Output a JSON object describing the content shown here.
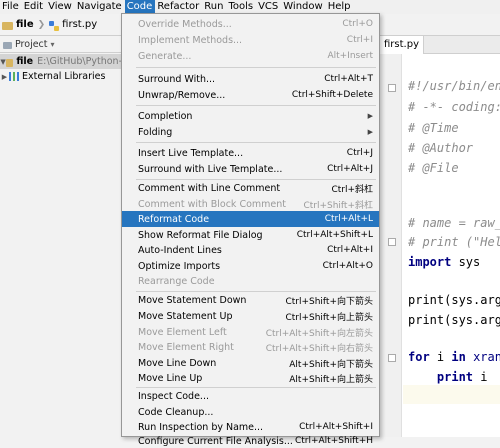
{
  "menubar": [
    "File",
    "Edit",
    "View",
    "Navigate",
    "Code",
    "Refactor",
    "Run",
    "Tools",
    "VCS",
    "Window",
    "Help"
  ],
  "navbar": {
    "folder": "file",
    "file": "first.py"
  },
  "project_panel": {
    "title": "Project",
    "root_name": "file",
    "root_path": "E:\\GitHub\\Python-",
    "libraries": "External Libraries"
  },
  "editor": {
    "tab_label": "first.py",
    "lines": [
      "#!/usr/bin/en",
      "# -*- coding:",
      "# @Time",
      "# @Author",
      "# @File",
      "",
      "",
      "# name = raw_",
      "# print (\"Hel",
      "import sys",
      "",
      "print(sys.arg",
      "print(sys.arg",
      "",
      "for i in xran",
      "    print i"
    ]
  },
  "code_menu": {
    "items": [
      {
        "label": "Override Methods...",
        "shortcut": "Ctrl+O",
        "disabled": true
      },
      {
        "label": "Implement Methods...",
        "shortcut": "Ctrl+I",
        "disabled": true
      },
      {
        "label": "Generate...",
        "shortcut": "Alt+Insert",
        "disabled": true
      },
      {
        "label": "Surround With...",
        "shortcut": "Ctrl+Alt+T"
      },
      {
        "label": "Unwrap/Remove...",
        "shortcut": "Ctrl+Shift+Delete"
      },
      {
        "label": "Completion",
        "shortcut": "",
        "submenu": true
      },
      {
        "label": "Folding",
        "shortcut": "",
        "submenu": true
      },
      {
        "label": "Insert Live Template...",
        "shortcut": "Ctrl+J"
      },
      {
        "label": "Surround with Live Template...",
        "shortcut": "Ctrl+Alt+J"
      },
      {
        "label": "Comment with Line Comment",
        "shortcut": "Ctrl+斜杠"
      },
      {
        "label": "Comment with Block Comment",
        "shortcut": "Ctrl+Shift+斜杠",
        "disabled": true
      },
      {
        "label": "Reformat Code",
        "shortcut": "Ctrl+Alt+L",
        "highlighted": true
      },
      {
        "label": "Show Reformat File Dialog",
        "shortcut": "Ctrl+Alt+Shift+L"
      },
      {
        "label": "Auto-Indent Lines",
        "shortcut": "Ctrl+Alt+I"
      },
      {
        "label": "Optimize Imports",
        "shortcut": "Ctrl+Alt+O"
      },
      {
        "label": "Rearrange Code",
        "shortcut": "",
        "disabled": true
      },
      {
        "label": "Move Statement Down",
        "shortcut": "Ctrl+Shift+向下箭头"
      },
      {
        "label": "Move Statement Up",
        "shortcut": "Ctrl+Shift+向上箭头"
      },
      {
        "label": "Move Element Left",
        "shortcut": "Ctrl+Alt+Shift+向左箭头",
        "disabled": true
      },
      {
        "label": "Move Element Right",
        "shortcut": "Ctrl+Alt+Shift+向右箭头",
        "disabled": true
      },
      {
        "label": "Move Line Down",
        "shortcut": "Alt+Shift+向下箭头"
      },
      {
        "label": "Move Line Up",
        "shortcut": "Alt+Shift+向上箭头"
      },
      {
        "label": "Inspect Code...",
        "shortcut": ""
      },
      {
        "label": "Code Cleanup...",
        "shortcut": ""
      },
      {
        "label": "Run Inspection by Name...",
        "shortcut": "Ctrl+Alt+Shift+I"
      },
      {
        "label": "Configure Current File Analysis...",
        "shortcut": "Ctrl+Alt+Shift+H"
      }
    ]
  },
  "colors": {
    "menu_highlight": "#2675bf",
    "comment": "#8c8c8c",
    "keyword": "#000080"
  }
}
